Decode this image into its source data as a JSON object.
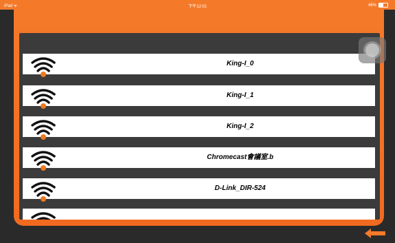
{
  "status_bar": {
    "left": "iPad ᯤ",
    "time": "下午12:01",
    "battery": "46%"
  },
  "networks": [
    {
      "ssid": "King-I_0"
    },
    {
      "ssid": "King-I_1"
    },
    {
      "ssid": "King-I_2"
    },
    {
      "ssid": "Chromecast會議室.b"
    },
    {
      "ssid": "D-Link_DIR-524"
    },
    {
      "ssid": ""
    }
  ],
  "colors": {
    "accent": "#f47a2a",
    "panel": "#3b3b3b",
    "wifi_dot": "#f07a20"
  },
  "icons": {
    "wifi": "wifi-icon",
    "back": "back-arrow-icon"
  }
}
